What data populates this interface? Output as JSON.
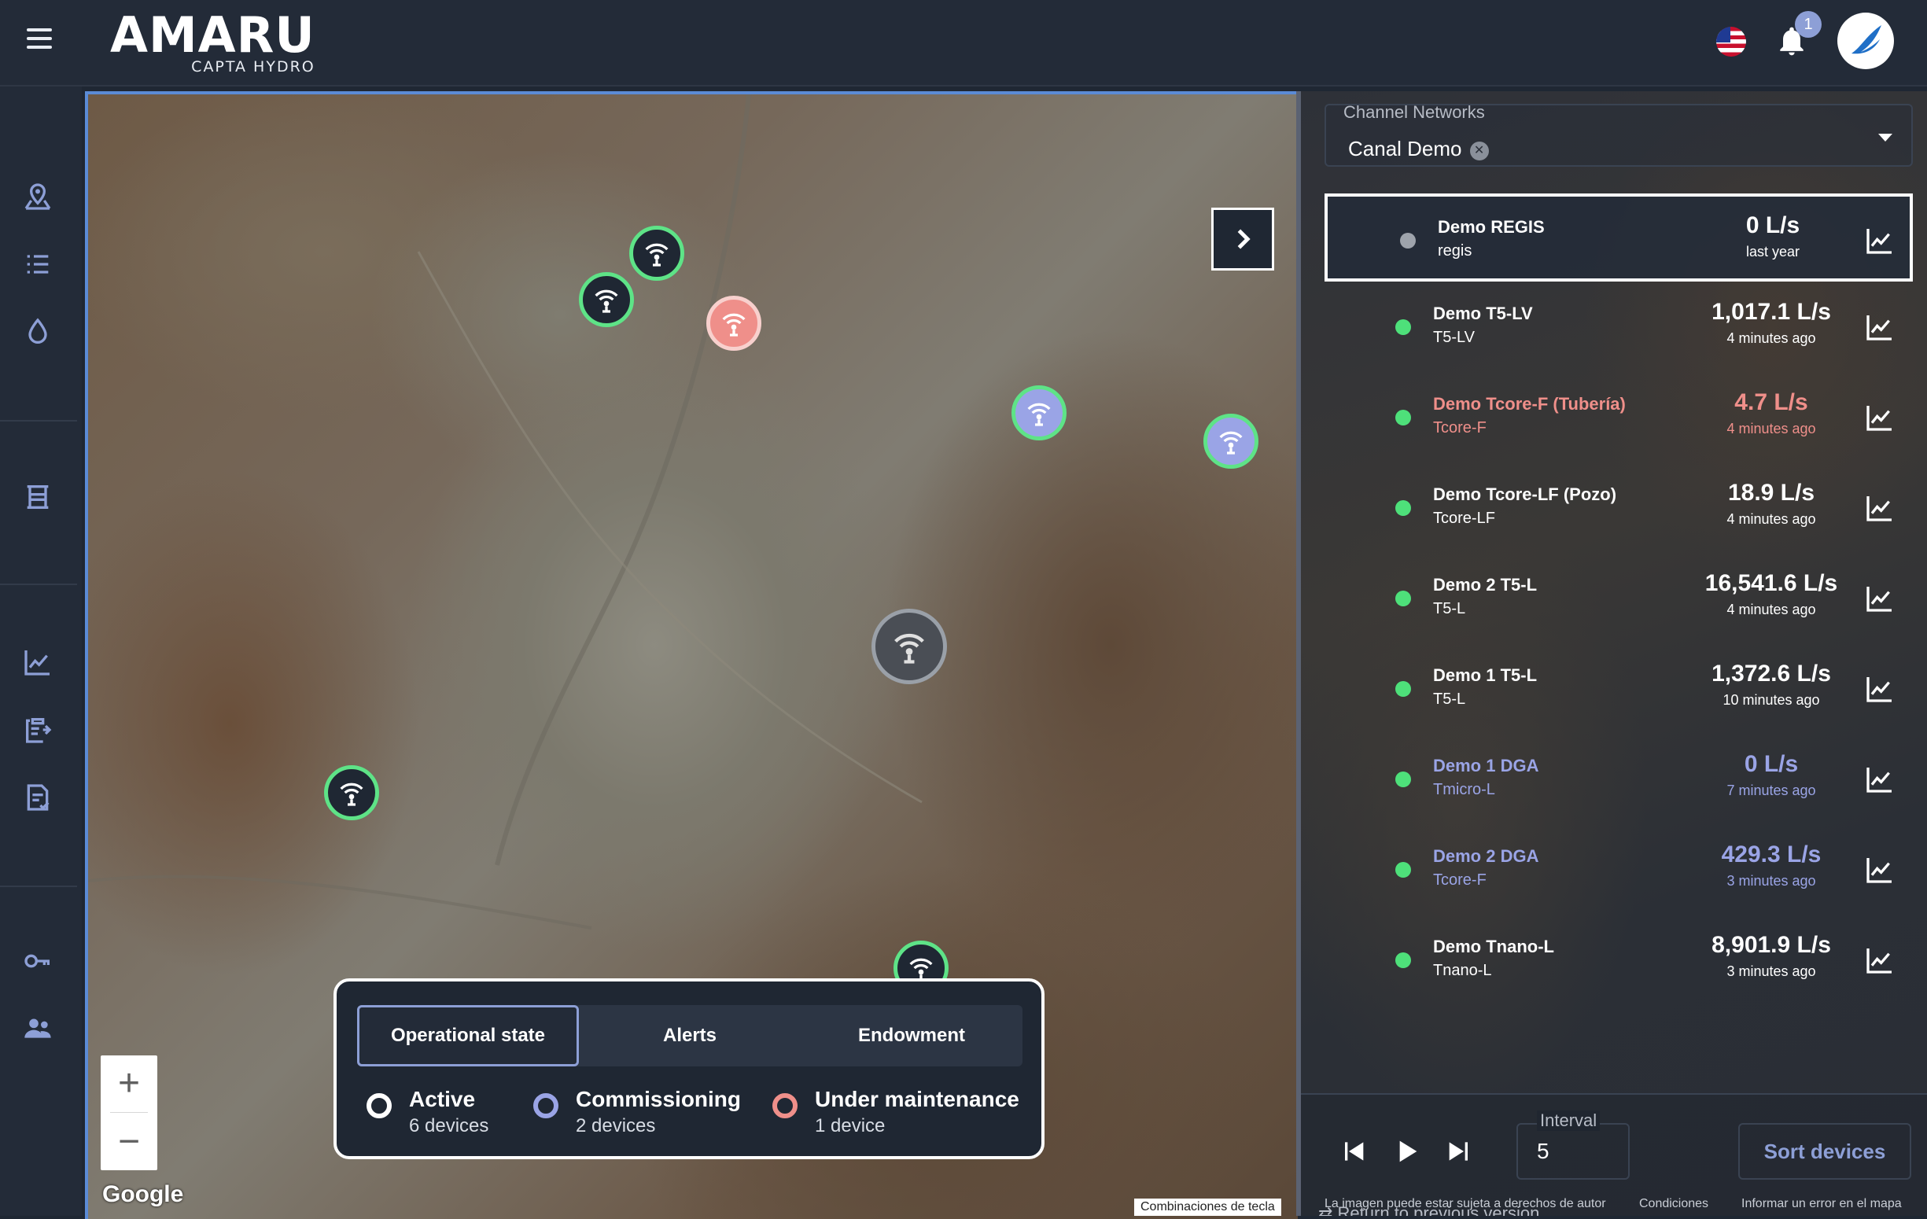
{
  "header": {
    "logo": "AMARU",
    "logo_sub": "CAPTA HYDRO",
    "notification_count": "1"
  },
  "map": {
    "toggle_icon": "chevron-right-icon",
    "zoom_in": "+",
    "zoom_out": "−",
    "google": "Google",
    "keyboard_shortcuts": "Combinaciones de tecla",
    "legend": {
      "tabs": [
        "Operational state",
        "Alerts",
        "Endowment"
      ],
      "items": [
        {
          "title": "Active",
          "count": "6 devices",
          "color": "#ffffff"
        },
        {
          "title": "Commissioning",
          "count": "2 devices",
          "color": "#9aa4e6"
        },
        {
          "title": "Under maintenance",
          "count": "1 device",
          "color": "#ef8f8a"
        }
      ]
    }
  },
  "panel": {
    "select_label": "Channel Networks",
    "select_value": "Canal Demo",
    "devices": [
      {
        "name": "Demo REGIS",
        "type": "regis",
        "value": "0 L/s",
        "time": "last year",
        "status": "gray"
      },
      {
        "name": "Demo T5-LV",
        "type": "T5-LV",
        "value": "1,017.1 L/s",
        "time": "4 minutes ago",
        "status": "active"
      },
      {
        "name": "Demo Tcore-F (Tubería)",
        "type": "Tcore-F",
        "value": "4.7 L/s",
        "time": "4 minutes ago",
        "status": "maintenance"
      },
      {
        "name": "Demo Tcore-LF (Pozo)",
        "type": "Tcore-LF",
        "value": "18.9 L/s",
        "time": "4 minutes ago",
        "status": "active"
      },
      {
        "name": "Demo 2 T5-L",
        "type": "T5-L",
        "value": "16,541.6 L/s",
        "time": "4 minutes ago",
        "status": "active"
      },
      {
        "name": "Demo 1 T5-L",
        "type": "T5-L",
        "value": "1,372.6 L/s",
        "time": "10 minutes ago",
        "status": "active"
      },
      {
        "name": "Demo 1 DGA",
        "type": "Tmicro-L",
        "value": "0 L/s",
        "time": "7 minutes ago",
        "status": "commissioning"
      },
      {
        "name": "Demo 2 DGA",
        "type": "Tcore-F",
        "value": "429.3 L/s",
        "time": "3 minutes ago",
        "status": "commissioning"
      },
      {
        "name": "Demo Tnano-L",
        "type": "Tnano-L",
        "value": "8,901.9 L/s",
        "time": "3 minutes ago",
        "status": "active"
      }
    ],
    "interval_label": "Interval",
    "interval_value": "5",
    "sort_label": "Sort devices",
    "return_label": "Return to previous version",
    "google_notes": [
      "La imagen puede estar sujeta a derechos de autor",
      "Condiciones",
      "Informar un error en el mapa"
    ]
  },
  "colors": {
    "active": "#4ee07a",
    "commissioning": "#9aa4e6",
    "maintenance": "#ef8f8a",
    "accent": "#8d9fd6"
  }
}
